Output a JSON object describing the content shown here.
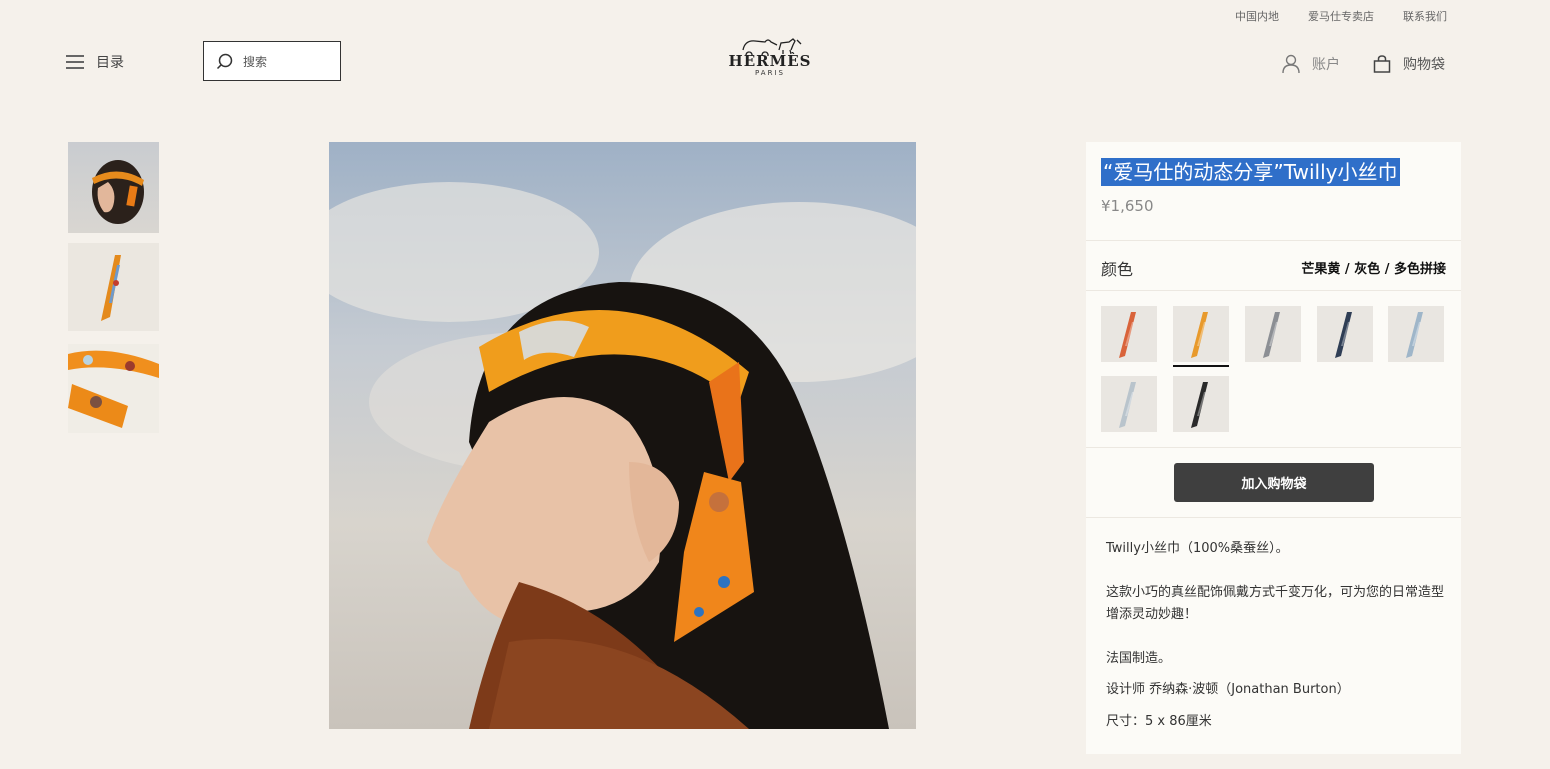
{
  "header": {
    "utility_links": [
      "中国内地",
      "爱马仕专卖店",
      "联系我们"
    ],
    "menu_label": "目录",
    "search_placeholder": "搜索",
    "logo_name": "HERMÈS",
    "logo_sub": "PARIS",
    "account_label": "账户",
    "bag_label": "购物袋"
  },
  "product": {
    "title": "“爱马仕的动态分享”Twilly小丝巾",
    "price": "¥1,650",
    "color_label": "颜色",
    "color_value": "芒果黄 / 灰色 / 多色拼接",
    "add_to_bag": "加入购物袋",
    "description": {
      "line1": "Twilly小丝巾（100%桑蚕丝）。",
      "line2": "这款小巧的真丝配饰佩戴方式千变万化，可为您的日常造型增添灵动妙趣！",
      "line3": "法国制造。",
      "line4": "设计师 乔纳森·波顿（Jonathan Burton）",
      "line5": "尺寸：5 x 86厘米"
    }
  },
  "swatches": [
    {
      "name": "swatch-red-orange",
      "color": "#d9633a",
      "selected": false
    },
    {
      "name": "swatch-mango-yellow",
      "color": "#e89a2c",
      "selected": true
    },
    {
      "name": "swatch-grey-multi",
      "color": "#8c8f94",
      "selected": false
    },
    {
      "name": "swatch-navy-teal",
      "color": "#2f3e55",
      "selected": false
    },
    {
      "name": "swatch-light-blue",
      "color": "#9fb6c9",
      "selected": false
    },
    {
      "name": "swatch-pale-grey",
      "color": "#b9c4cc",
      "selected": false
    },
    {
      "name": "swatch-black",
      "color": "#2a2a2a",
      "selected": false
    }
  ]
}
